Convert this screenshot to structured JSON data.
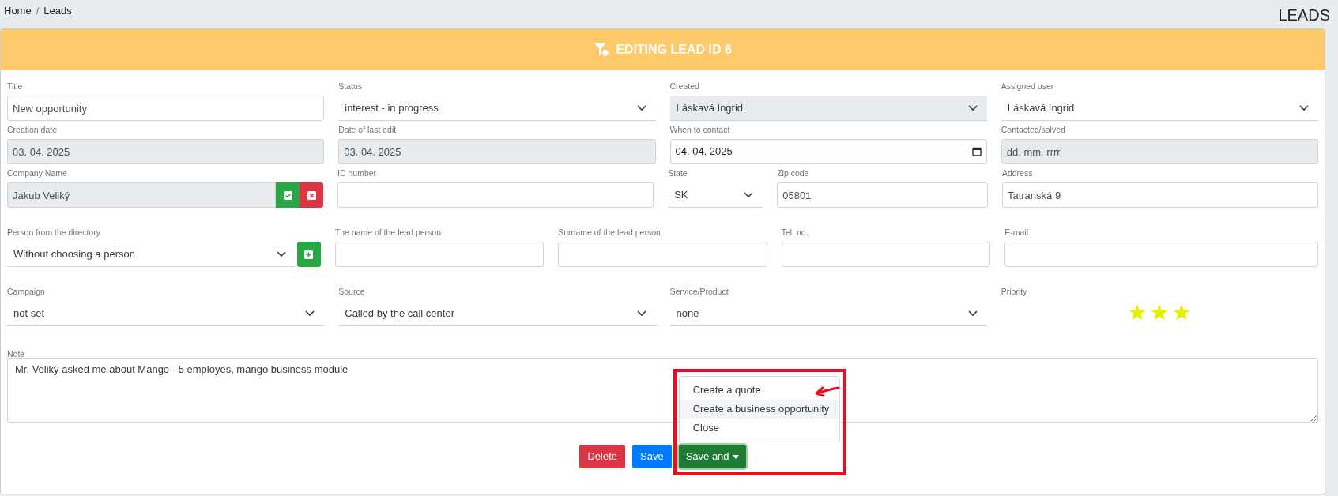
{
  "breadcrumb": {
    "items": [
      "Home",
      "Leads"
    ],
    "separator": "/"
  },
  "page_title": "LEADS",
  "card": {
    "title": "EDITING LEAD ID 6"
  },
  "rows": [
    [
      {
        "kind": "input",
        "label": "Title",
        "value": "New opportunity",
        "disabled": false
      },
      {
        "kind": "select",
        "label": "Status",
        "value": "interest - in progress",
        "disabled": false
      },
      {
        "kind": "select",
        "label": "Created",
        "value": "Láskavá Ingrid",
        "disabled": true
      },
      {
        "kind": "select",
        "label": "Assigned user",
        "value": "Láskavá Ingrid",
        "disabled": false
      }
    ],
    [
      {
        "kind": "input",
        "label": "Creation date",
        "value": "03. 04. 2025",
        "disabled": true
      },
      {
        "kind": "input",
        "label": "Date of last edit",
        "value": "03. 04. 2025",
        "disabled": true
      },
      {
        "kind": "date",
        "label": "When to contact",
        "value": "04. 04. 2025",
        "disabled": false
      },
      {
        "kind": "input",
        "label": "Contacted/solved",
        "value": "dd. mm. rrrr",
        "disabled": true
      }
    ],
    [
      {
        "kind": "company",
        "label": "Company Name",
        "value": "Jakub Veliký",
        "disabled": true
      },
      {
        "kind": "input",
        "label": "ID number",
        "disabled": false
      },
      {
        "kind": "select",
        "label": "State",
        "value": "SK",
        "disabled": false
      },
      {
        "kind": "input",
        "label": "Zip code",
        "value": "05801",
        "disabled": false
      },
      {
        "kind": "input",
        "label": "Address",
        "value": "Tatranská 9",
        "disabled": false
      }
    ],
    [
      {
        "kind": "person",
        "label": "Person from the directory",
        "value": "Without choosing a person",
        "disabled": false
      },
      {
        "kind": "input",
        "label": "The name of the lead person",
        "disabled": false
      },
      {
        "kind": "input",
        "label": "Surname of the lead person",
        "disabled": false
      },
      {
        "kind": "input",
        "label": "Tel. no.",
        "disabled": false
      },
      {
        "kind": "input",
        "label": "E-mail",
        "disabled": false
      }
    ],
    [
      {
        "kind": "select",
        "label": "Campaign",
        "value": "not set",
        "disabled": false
      },
      {
        "kind": "select",
        "label": "Source",
        "value": "Called by the call center",
        "disabled": false
      },
      {
        "kind": "select",
        "label": "Service/Product",
        "value": "none",
        "disabled": false
      },
      {
        "kind": "stars",
        "label": "Priority",
        "stars": 3
      }
    ]
  ],
  "note": {
    "label": "Note",
    "value": "Mr. Veliký asked me about Mango - 5 employes, mango business module"
  },
  "buttons": {
    "delete": "Delete",
    "save": "Save",
    "save_and": "Save and"
  },
  "save_and_menu": [
    {
      "label": "Create a quote",
      "highlighted": false
    },
    {
      "label": "Create a business opportunity",
      "highlighted": true
    },
    {
      "label": "Close",
      "highlighted": false
    }
  ]
}
